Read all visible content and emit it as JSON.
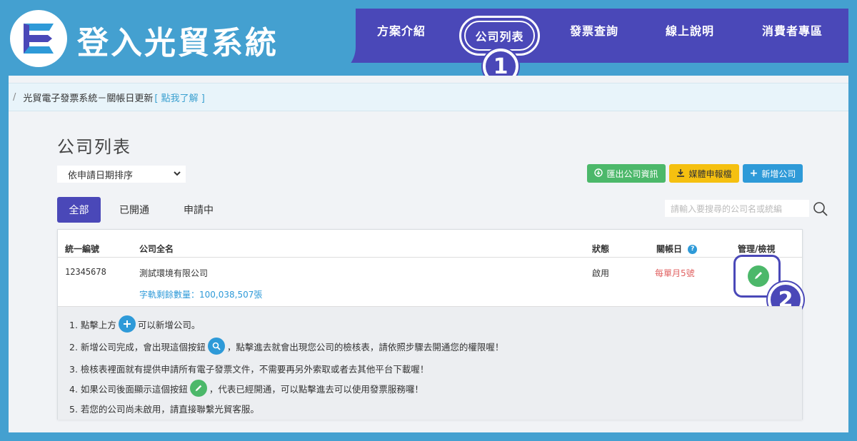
{
  "brand": {
    "title": "登入光貿系統",
    "logo_icon": "e-logo-icon"
  },
  "nav": {
    "items": [
      {
        "label": "方案介紹"
      },
      {
        "label": "公司列表"
      },
      {
        "label": "發票查詢"
      },
      {
        "label": "線上說明"
      },
      {
        "label": "消費者專區"
      }
    ],
    "active_index": 1
  },
  "steps": {
    "one": "1",
    "two": "2"
  },
  "notice": {
    "slash": "/",
    "text": "光貿電子發票系統－關帳日更新",
    "link": "[ 點我了解 ]"
  },
  "page": {
    "title": "公司列表",
    "sort_selected": "依申請日期排序"
  },
  "actions": {
    "export_label": "匯出公司資訊",
    "media_label": "媒體申報檔",
    "add_label": "新增公司"
  },
  "tabs": [
    {
      "label": "全部"
    },
    {
      "label": "已開通"
    },
    {
      "label": "申請中"
    }
  ],
  "search": {
    "placeholder": "請輸入要搜尋的公司名或統編"
  },
  "table": {
    "columns": {
      "tax_id": "統一編號",
      "name": "公司全名",
      "status": "狀態",
      "close_day": "關帳日",
      "manage": "管理/檢視"
    },
    "rows": [
      {
        "tax_id": "12345678",
        "name": "測試環境有限公司",
        "remaining": "字軌剩餘數量：100,038,507張",
        "status": "啟用",
        "close_day": "每單月5號"
      }
    ]
  },
  "instructions": {
    "l1a": "1. 點擊上方",
    "l1b": "可以新增公司。",
    "l2a": "2. 新增公司完成，會出現這個按鈕",
    "l2b": "，點擊進去就會出現您公司的檢核表，請依照步驟去開通您的權限喔！",
    "l3": "3. 檢核表裡面就有提供申請所有電子發票文件，不需要再另外索取或者去其他平台下載喔！",
    "l4a": "4. 如果公司後面顯示這個按鈕",
    "l4b": "，代表已經開通，可以點擊進去可以使用發票服務囉！",
    "l5": "5. 若您的公司尚未啟用，請直接聯繫光貿客服。"
  },
  "colors": {
    "nav": "#4a48b8",
    "frame": "#44a0d0",
    "green": "#4cb86a",
    "yellow": "#f5c010",
    "blue": "#2e9ad8",
    "close_day": "#e06060"
  }
}
